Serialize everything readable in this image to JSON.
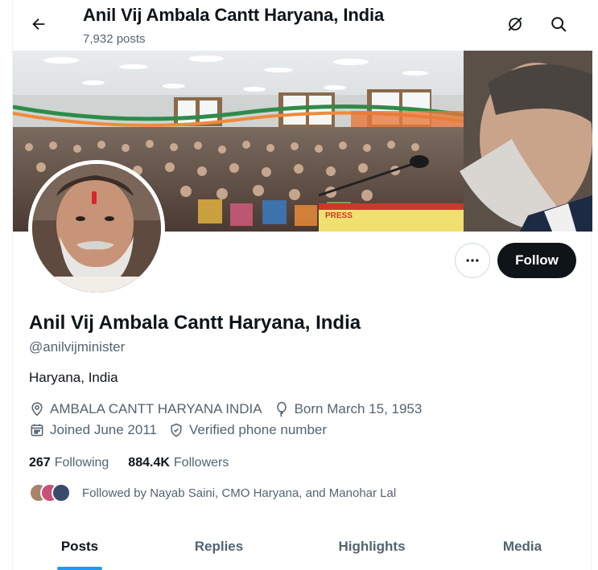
{
  "header": {
    "title": "Anil Vij Ambala Cantt Haryana, India",
    "posts_count": "7,932 posts"
  },
  "profile": {
    "name": "Anil Vij Ambala Cantt Haryana, India",
    "handle": "@anilvijminister",
    "bio": "Haryana, India",
    "location": "AMBALA CANTT HARYANA INDIA",
    "birthday": "Born March 15, 1953",
    "joined": "Joined June 2011",
    "verification": "Verified phone number",
    "following_count": "267",
    "following_label": "Following",
    "followers_count": "884.4K",
    "followers_label": "Followers",
    "followed_by": "Followed by Nayab Saini, CMO Haryana, and Manohar Lal"
  },
  "actions": {
    "follow_label": "Follow"
  },
  "banner": {
    "press_text": "PRESS"
  },
  "tabs": [
    {
      "label": "Posts",
      "active": true
    },
    {
      "label": "Replies",
      "active": false
    },
    {
      "label": "Highlights",
      "active": false
    },
    {
      "label": "Media",
      "active": false
    }
  ],
  "icons": [
    "back-arrow-icon",
    "grok-icon",
    "search-icon",
    "more-icon",
    "location-icon",
    "balloon-icon",
    "calendar-icon",
    "shield-check-icon"
  ],
  "colors": {
    "accent": "#1d9bf0",
    "text": "#0f1419",
    "secondary": "#536471",
    "follow_bg": "#0f1419"
  }
}
